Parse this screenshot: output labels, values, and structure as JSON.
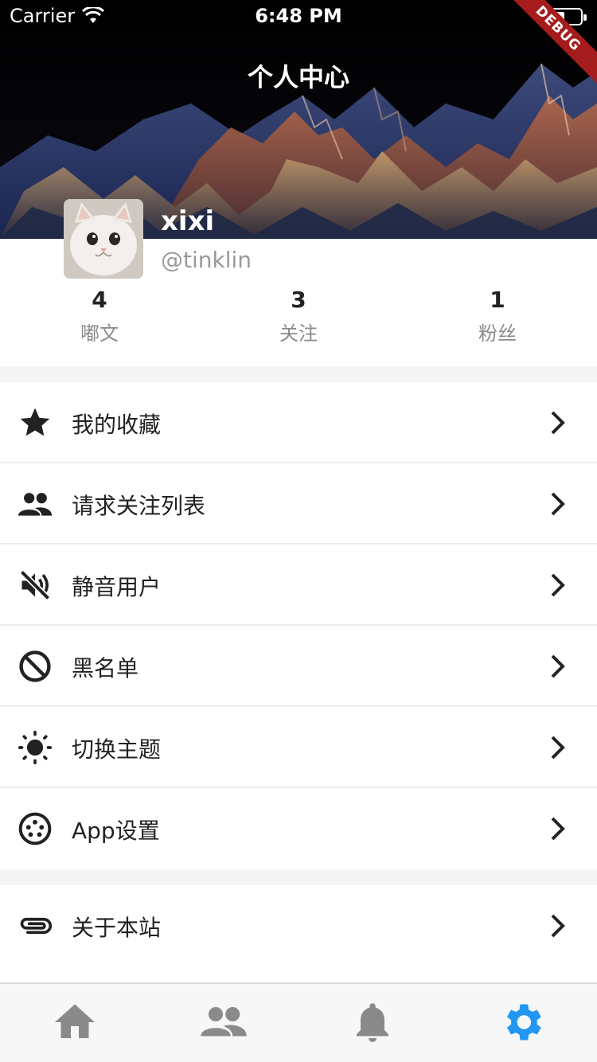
{
  "status_bar": {
    "carrier": "Carrier",
    "time": "6:48 PM"
  },
  "debug_banner": "DEBUG",
  "header": {
    "title": "个人中心"
  },
  "profile": {
    "name": "xixi",
    "handle": "@tinklin",
    "stats": [
      {
        "value": "4",
        "label": "嘟文"
      },
      {
        "value": "3",
        "label": "关注"
      },
      {
        "value": "1",
        "label": "粉丝"
      }
    ]
  },
  "menu": {
    "group1": [
      {
        "icon": "star-icon",
        "label": "我的收藏"
      },
      {
        "icon": "people-icon",
        "label": "请求关注列表"
      },
      {
        "icon": "volume-off-icon",
        "label": "静音用户"
      },
      {
        "icon": "block-icon",
        "label": "黑名单"
      },
      {
        "icon": "brightness-icon",
        "label": "切换主题"
      },
      {
        "icon": "settings-input-icon",
        "label": "App设置"
      }
    ],
    "group2": [
      {
        "icon": "attachment-icon",
        "label": "关于本站"
      }
    ]
  },
  "tabbar": {
    "tabs": [
      {
        "icon": "home-icon",
        "active": false
      },
      {
        "icon": "people-icon",
        "active": false
      },
      {
        "icon": "bell-icon",
        "active": false
      },
      {
        "icon": "gear-icon",
        "active": true
      }
    ],
    "active_color": "#2196f3",
    "inactive_color": "#8a8a8a"
  }
}
